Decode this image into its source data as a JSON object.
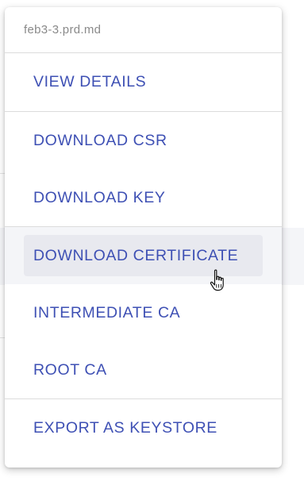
{
  "menu": {
    "header": "feb3-3.prd.md",
    "groups": [
      {
        "items": [
          {
            "label": "VIEW DETAILS"
          }
        ]
      },
      {
        "items": [
          {
            "label": "DOWNLOAD CSR"
          },
          {
            "label": "DOWNLOAD KEY"
          }
        ]
      },
      {
        "items": [
          {
            "label": "DOWNLOAD CERTIFICATE",
            "hovered": true
          },
          {
            "label": "INTERMEDIATE CA"
          },
          {
            "label": "ROOT CA"
          }
        ]
      },
      {
        "items": [
          {
            "label": "EXPORT AS KEYSTORE"
          }
        ]
      }
    ]
  },
  "colors": {
    "item_text": "#3e50b4",
    "header_text": "#8a8a8a",
    "hover_highlight": "#e8e9ef"
  },
  "cursor": {
    "icon": "hand-pointer-icon"
  }
}
